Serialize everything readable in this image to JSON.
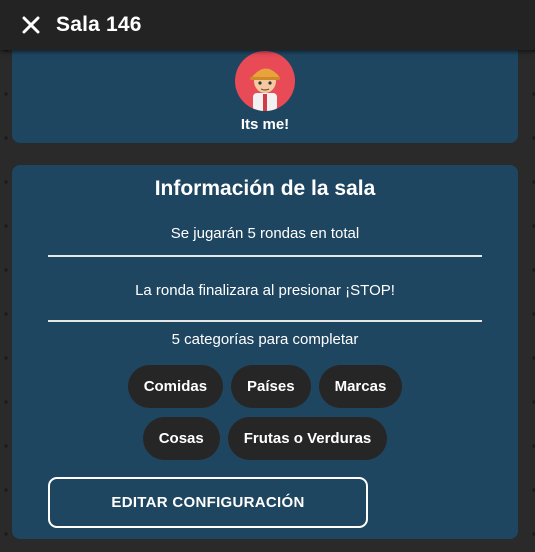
{
  "header": {
    "title": "Sala 146"
  },
  "player": {
    "name": "Its me!"
  },
  "room_info": {
    "title": "Información de la sala",
    "rounds_text": "Se jugarán 5 rondas en total",
    "round_end_text": "La ronda finalizara al presionar ¡STOP!",
    "categories_text": "5 categorías para completar",
    "categories": [
      "Comidas",
      "Países",
      "Marcas",
      "Cosas",
      "Frutas o Verduras"
    ],
    "edit_button_label": "EDITAR CONFIGURACIÓN"
  },
  "colors": {
    "background": "#2a2a2a",
    "card": "#1f4660",
    "chip": "#262626",
    "avatar_bg": "#e84a56"
  },
  "icons": {
    "close": "close-icon",
    "avatar": "avatar-icon"
  }
}
